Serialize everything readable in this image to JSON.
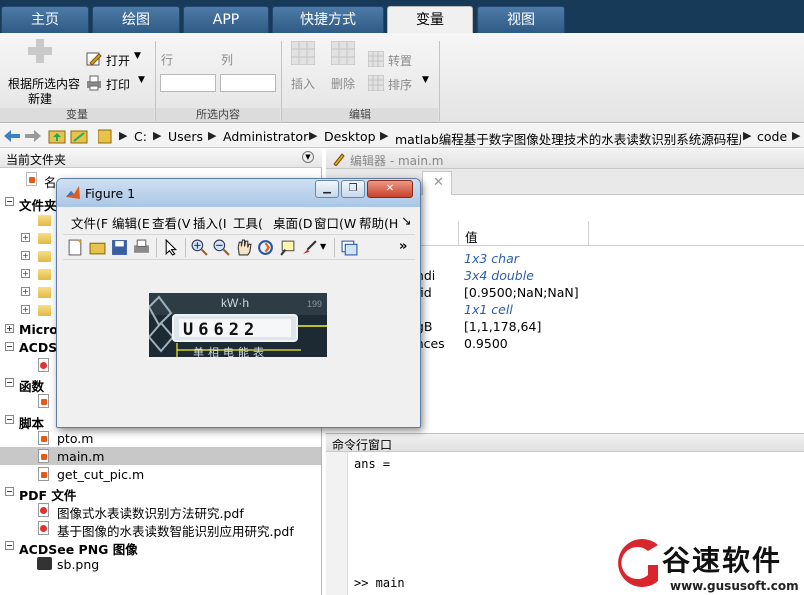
{
  "tabs": [
    "主页",
    "绘图",
    "APP",
    "快捷方式",
    "变量",
    "视图"
  ],
  "active_tab": "变量",
  "ribbon": {
    "new_from_selection": [
      "根据所选内容",
      "新建"
    ],
    "open_label": "打开",
    "print_label": "打印",
    "row_label": "行",
    "col_label": "列",
    "insert_label": "插入",
    "delete_label": "删除",
    "transpose_label": "转置",
    "sort_label": "排序",
    "group_variable": "变量",
    "group_selection": "所选内容",
    "group_edit": "编辑"
  },
  "address": {
    "crumbs": [
      "C:",
      "Users",
      "Administrator",
      "Desktop",
      "matlab编程基于数字图像处理技术的水表读数识别系统源码程序",
      "code"
    ]
  },
  "current_folder": {
    "title": "当前文件夹",
    "name_col": "名",
    "sections": {
      "folder": "文件夹",
      "microsoft": "Micros",
      "acdsee": "ACDSe",
      "functions": "函数",
      "scripts": "脚本",
      "pdf": "PDF 文件",
      "png": "ACDSee PNG 图像"
    },
    "scripts": [
      "pto.m",
      "main.m",
      "get_cut_pic.m"
    ],
    "pdfs": [
      "图像式水表读数识别方法研究.pdf",
      "基于图像的水表读数智能识别应用研究.pdf"
    ],
    "pngs": [
      "sb.png"
    ],
    "selected": "main.m"
  },
  "editor": {
    "title": "编辑器 - main.m"
  },
  "workspace": {
    "value_header": "值",
    "rows": [
      {
        "name": "",
        "value": "1x3 char",
        "style": "italic"
      },
      {
        "name": "undi",
        "value": "3x4 double",
        "style": "italic"
      },
      {
        "name": "nfid",
        "value": "[0.9500;NaN;NaN]",
        "style": "normal"
      },
      {
        "name": "",
        "value": "1x1 cell",
        "style": "italic"
      },
      {
        "name": "ngB",
        "value": "[1,1,178,64]",
        "style": "normal"
      },
      {
        "name": "ences",
        "value": "0.9500",
        "style": "normal"
      }
    ]
  },
  "command_window": {
    "title": "命令行窗口",
    "output": "ans =",
    "prompt": ">> main"
  },
  "figure": {
    "title": "Figure 1",
    "menus": [
      "文件(F",
      "编辑(E",
      "查看(V",
      "插入(I",
      "工具(",
      "桌面(D",
      "窗口(W",
      "帮助(H"
    ],
    "overflow": "»",
    "image_digits": "U6622",
    "image_kwh": "kW·h",
    "image_number": "199",
    "image_caption": "单相电能表"
  },
  "watermark": {
    "brand": "谷速软件",
    "url": "www.gususoft.com"
  },
  "colors": {
    "tab_bar": "#173a59",
    "accent_blue": "#2c5ea8",
    "selection": "#c8c8c8"
  }
}
